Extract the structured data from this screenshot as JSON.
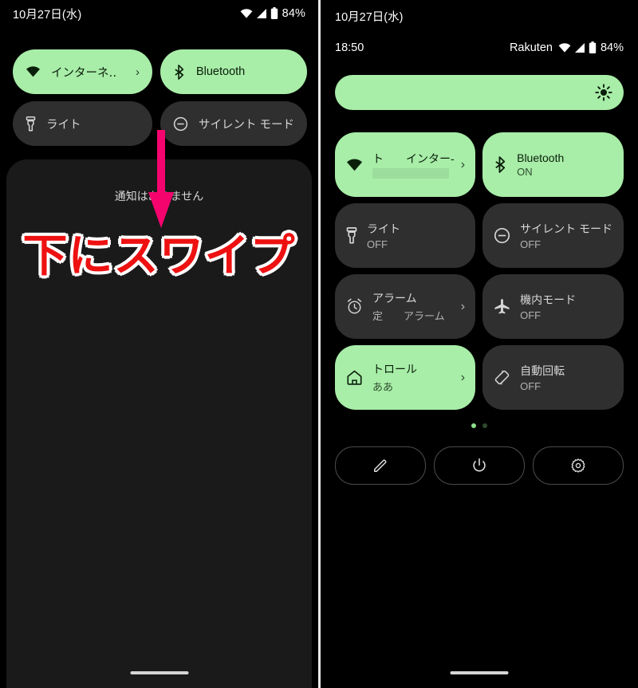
{
  "left": {
    "statusbar": {
      "date": "10月27日(水)",
      "battery_pct": "84%",
      "icons": [
        "wifi-icon",
        "cell-signal-icon",
        "battery-icon"
      ]
    },
    "tiles": [
      {
        "name": "internet",
        "label": "インターネ‥",
        "state": "on",
        "chevron": "›"
      },
      {
        "name": "bluetooth",
        "label": "Bluetooth",
        "state": "on",
        "chevron": ""
      },
      {
        "name": "flashlight",
        "label": "ライト",
        "state": "off",
        "chevron": ""
      },
      {
        "name": "silent-mode",
        "label": "サイレント モード",
        "state": "off",
        "chevron": ""
      }
    ],
    "shade": {
      "empty_text": "通知はありません"
    },
    "annotation": {
      "text": "下にスワイプ",
      "text_color": "#ee1111",
      "outline_color": "#ffffff",
      "arrow_color": "#f5046e",
      "arrow_direction": "down"
    }
  },
  "right": {
    "date": "10月27日(水)",
    "statusbar": {
      "time": "18:50",
      "carrier": "Rakuten",
      "battery_pct": "84%"
    },
    "brightness": {
      "icon": "brightness-icon"
    },
    "tiles": [
      {
        "name": "internet",
        "title": "ト　　インター‑",
        "sub": "",
        "sub_redacted": true,
        "state": "on",
        "chevron": "›",
        "icon": "wifi-icon"
      },
      {
        "name": "bluetooth",
        "title": "Bluetooth",
        "sub": "ON",
        "sub_redacted": false,
        "state": "on",
        "chevron": "",
        "icon": "bluetooth-icon"
      },
      {
        "name": "flashlight",
        "title": "ライト",
        "sub": "OFF",
        "sub_redacted": false,
        "state": "off",
        "chevron": "",
        "icon": "flashlight-icon"
      },
      {
        "name": "silent-mode",
        "title": "サイレント モード",
        "sub": "OFF",
        "sub_redacted": false,
        "state": "off",
        "chevron": "",
        "icon": "do-not-disturb-icon"
      },
      {
        "name": "alarm",
        "title": "アラーム",
        "sub": "定　　アラーム",
        "sub_redacted": false,
        "state": "off",
        "chevron": "›",
        "icon": "alarm-clock-icon"
      },
      {
        "name": "airplane-mode",
        "title": "機内モード",
        "sub": "OFF",
        "sub_redacted": false,
        "state": "off",
        "chevron": "",
        "icon": "airplane-icon"
      },
      {
        "name": "home-controls",
        "title": "トロール",
        "sub": "ああ",
        "sub_redacted": false,
        "state": "on",
        "chevron": "›",
        "icon": "home-icon"
      },
      {
        "name": "auto-rotate",
        "title": "自動回転",
        "sub": "OFF",
        "sub_redacted": false,
        "state": "off",
        "chevron": "",
        "icon": "auto-rotate-icon"
      }
    ],
    "pages": {
      "count": 2,
      "active_index": 0
    },
    "actions": [
      {
        "name": "edit",
        "icon": "pencil-icon"
      },
      {
        "name": "power",
        "icon": "power-icon"
      },
      {
        "name": "settings",
        "icon": "gear-icon"
      }
    ]
  },
  "colors": {
    "accent_green": "#a8eda8",
    "tile_off": "#2f2f2f",
    "shade_bg": "#1a1a1a",
    "annotation_red": "#ee1111",
    "arrow_pink": "#f5046e"
  }
}
